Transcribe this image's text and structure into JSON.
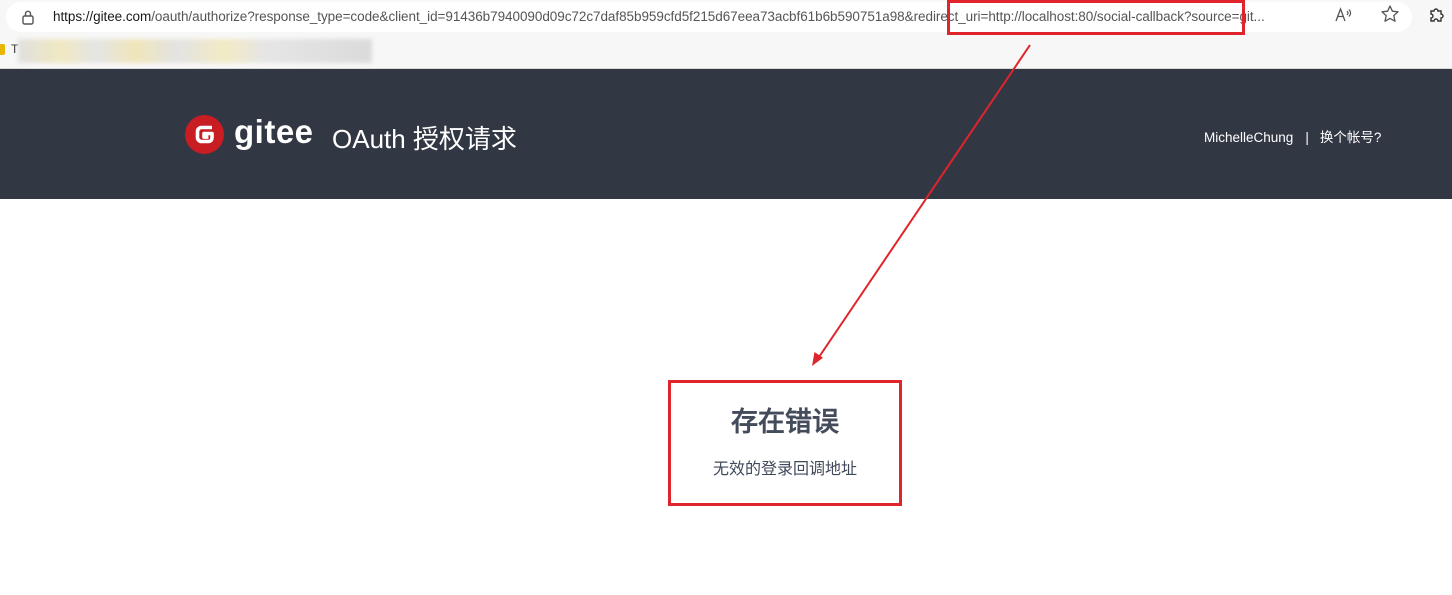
{
  "browser": {
    "url_host": "https://gitee.com",
    "url_rest": "/oauth/authorize?response_type=code&client_id=91436b7940090d09c72c7daf85b959cfd5f215d67eea73acbf61b6b590751a98&redirect_uri=http://localhost:80/social-callback?source=git...",
    "bookmark_letter": "T",
    "icons": [
      "lock-icon",
      "read-aloud-icon",
      "favorite-star-icon",
      "extensions-icon",
      "bookmark-folder-icon"
    ]
  },
  "header": {
    "logo_text": "gitee",
    "title": "OAuth 授权请求",
    "username": "MichelleChung",
    "separator": "|",
    "switch_account": "换个帐号?"
  },
  "error": {
    "title": "存在错误",
    "message": "无效的登录回调地址"
  },
  "colors": {
    "header_bg": "#323744",
    "brand_red": "#c71d23",
    "annotation_red": "#e0242b",
    "error_text": "#444b5a"
  }
}
